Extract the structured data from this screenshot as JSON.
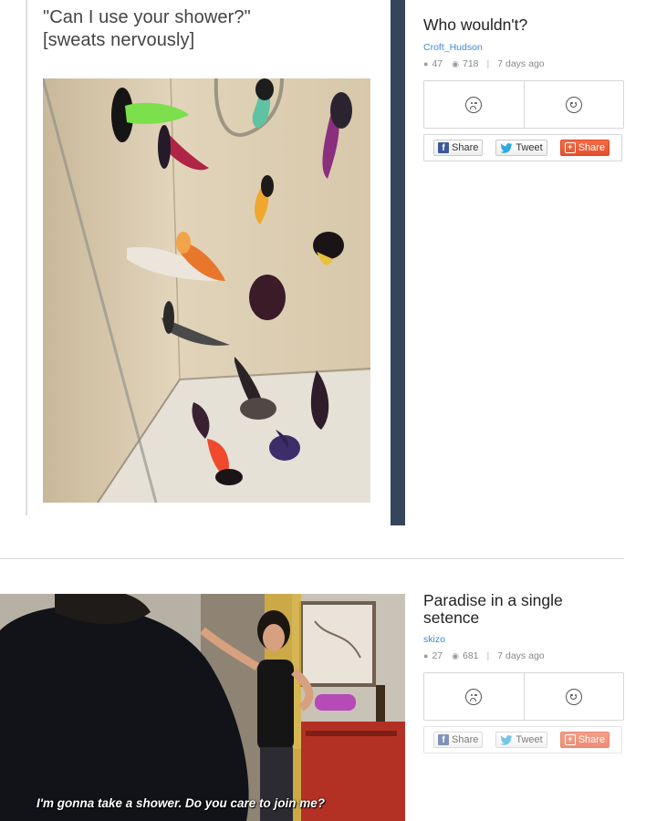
{
  "post1": {
    "text_lines": [
      "\"Can I use your shower?\"",
      "[sweats nervously]"
    ],
    "title": "Who wouldn't?",
    "author": "Croft_Hudson",
    "comments": "47",
    "views": "718",
    "time": "7 days ago"
  },
  "post2": {
    "title_lines": [
      "Paradise in a single",
      "setence"
    ],
    "author": "skizo",
    "comments": "27",
    "views": "681",
    "time": "7 days ago",
    "subtitle": "I'm gonna take a shower. Do you care to join me?"
  },
  "share": {
    "facebook_label": "Share",
    "twitter_label": "Tweet",
    "google_label": "Share"
  },
  "icons": {
    "comment": "comment-icon",
    "views": "views-icon",
    "sad": "sad-face-icon",
    "happy": "happy-face-icon"
  },
  "colors": {
    "accent_link": "#3c8bd6",
    "sidebar_strip": "#35465c",
    "facebook": "#3b5998",
    "google": "#e5512d"
  }
}
